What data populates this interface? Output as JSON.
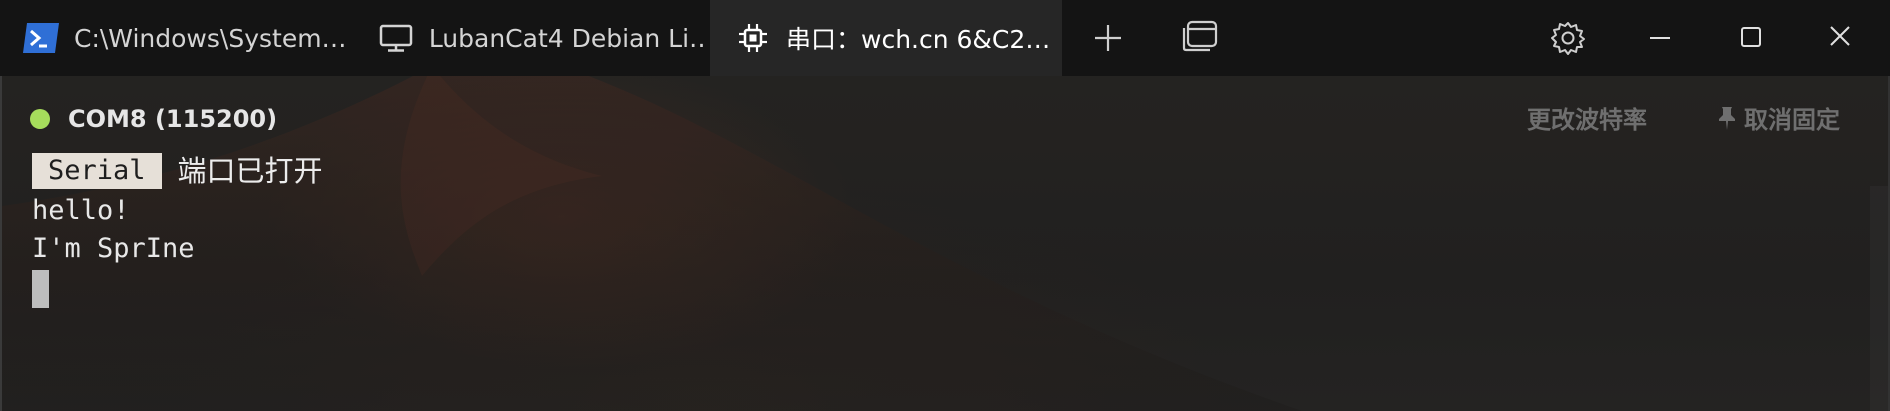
{
  "tabs": [
    {
      "label": "C:\\Windows\\System…",
      "icon": "powershell-icon"
    },
    {
      "label": "LubanCat4 Debian Li…",
      "icon": "monitor-icon"
    },
    {
      "label": "串口：wch.cn 6&C2…",
      "icon": "chip-icon"
    }
  ],
  "titlebar": {
    "new_tab": "+",
    "icons": [
      "plus-icon",
      "window-switch-icon",
      "gear-icon",
      "minimize-icon",
      "maximize-icon",
      "close-icon"
    ]
  },
  "status": {
    "connection": "COM8 (115200)",
    "dot_color": "#a6dd5c",
    "change_baud": "更改波特率",
    "unpin": "取消固定"
  },
  "terminal": {
    "badge": "Serial",
    "port_open": "端口已打开",
    "lines": [
      "hello!",
      "I'm SprIne"
    ]
  }
}
